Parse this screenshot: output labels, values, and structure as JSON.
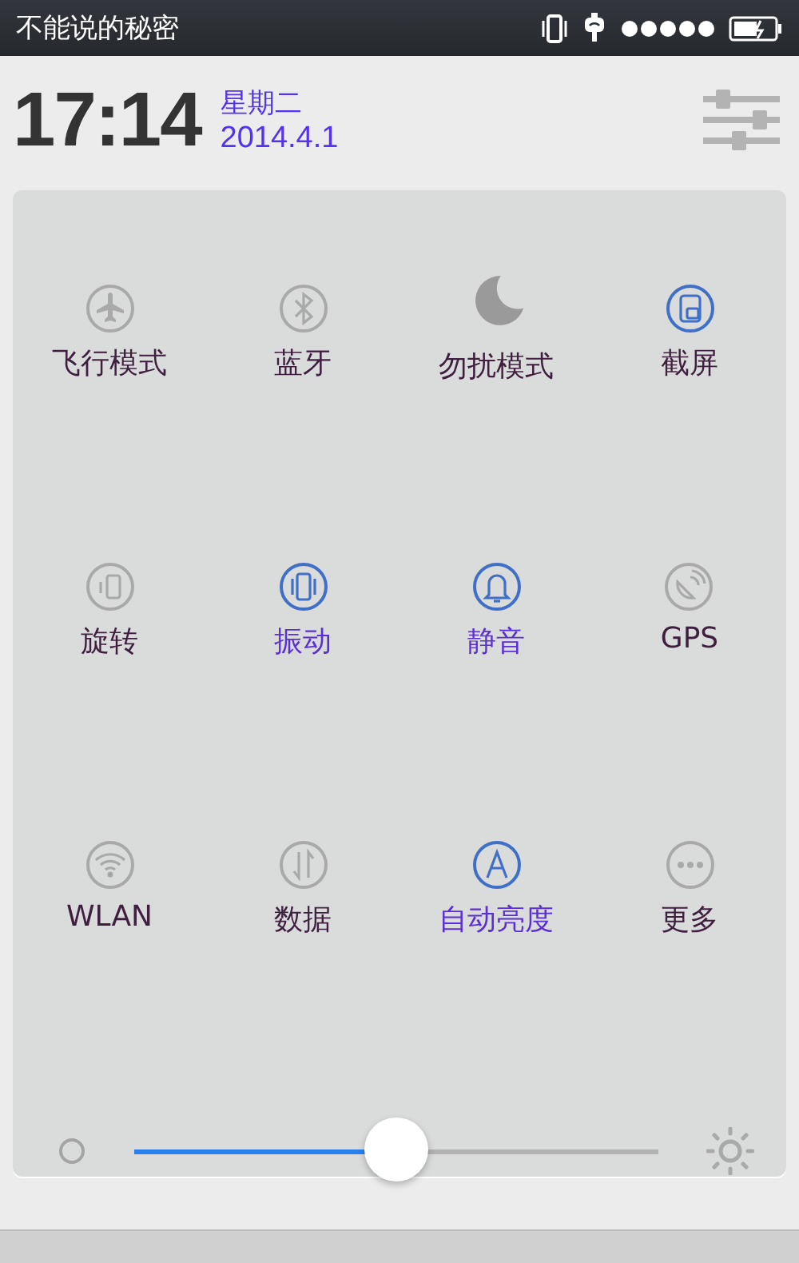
{
  "status_bar": {
    "title": "不能说的秘密"
  },
  "header": {
    "time": "17:14",
    "weekday": "星期二",
    "date": "2014.4.1"
  },
  "tiles": [
    {
      "label": "飞行模式",
      "kind": "toggle",
      "on": false
    },
    {
      "label": "蓝牙",
      "kind": "toggle",
      "on": false
    },
    {
      "label": "勿扰模式",
      "kind": "toggle",
      "on": false
    },
    {
      "label": "截屏",
      "kind": "action",
      "on": false
    },
    {
      "label": "旋转",
      "kind": "toggle",
      "on": false
    },
    {
      "label": "振动",
      "kind": "toggle",
      "on": true
    },
    {
      "label": "静音",
      "kind": "toggle",
      "on": true
    },
    {
      "label": "GPS",
      "kind": "toggle",
      "on": false
    },
    {
      "label": "WLAN",
      "kind": "toggle",
      "on": false
    },
    {
      "label": "数据",
      "kind": "toggle",
      "on": false
    },
    {
      "label": "自动亮度",
      "kind": "toggle",
      "on": true
    },
    {
      "label": "更多",
      "kind": "toggle",
      "on": false
    }
  ],
  "brightness": {
    "level": 0.5
  }
}
